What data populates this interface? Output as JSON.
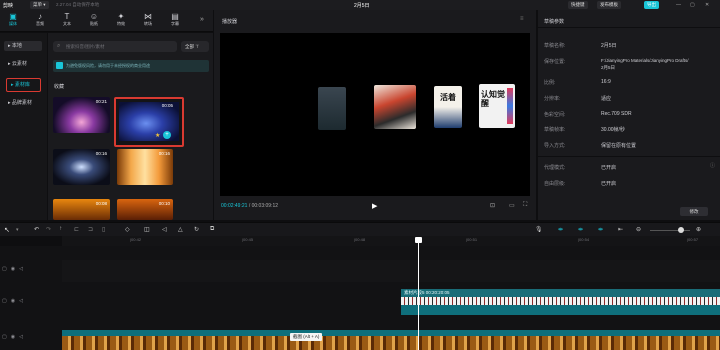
{
  "titlebar": {
    "app_name": "剪映",
    "menu": "菜单 ▾",
    "notice": "2.27.04 自动保存本地",
    "project_title": "2月5日",
    "btn_shortcut": "快捷键",
    "btn_template": "发布模板",
    "btn_export": "导出"
  },
  "toolbar": {
    "items": [
      {
        "icon": "media-icon",
        "glyph": "▣",
        "label": "媒体"
      },
      {
        "icon": "audio-icon",
        "glyph": "♪",
        "label": "音频"
      },
      {
        "icon": "text-icon",
        "glyph": "T",
        "label": "文本"
      },
      {
        "icon": "sticker-icon",
        "glyph": "☺",
        "label": "贴纸"
      },
      {
        "icon": "effects-icon",
        "glyph": "✦",
        "label": "特效"
      },
      {
        "icon": "transition-icon",
        "glyph": "⋈",
        "label": "转场"
      },
      {
        "icon": "caption-icon",
        "glyph": "▤",
        "label": "字幕"
      }
    ],
    "collapse": "»"
  },
  "sidebar": {
    "items": [
      {
        "label": "▸ 本地"
      },
      {
        "label": "▸ 云素材"
      },
      {
        "label": "▸ 素材库"
      },
      {
        "label": "▸ 品牌素材"
      }
    ]
  },
  "library": {
    "search_placeholder": "搜索抖音/图片/素材",
    "filter_label": "全部",
    "banner": "为避免版权风险，请勿用于未经授权的商业用途",
    "section": "收藏",
    "thumbs": [
      {
        "duration": "00:21"
      },
      {
        "duration": "00:05"
      },
      {
        "duration": "00:16"
      },
      {
        "duration": "00:16"
      },
      {
        "duration": "00:08"
      },
      {
        "duration": "00:10"
      }
    ]
  },
  "player": {
    "title": "播放器",
    "time_current": "00:02:49:21",
    "time_total": "00:03:09:12",
    "poster_texts": [
      "",
      "",
      "活着",
      "认知觉醒"
    ]
  },
  "details": {
    "title": "草稿参数",
    "rows": [
      {
        "k": "草稿名称:",
        "v": "2月5日"
      },
      {
        "k": "保存位置:",
        "v": "F:/JianyingPro Materials/JianyingPro Drafts/"
      },
      {
        "k": "",
        "v": "2月5日"
      },
      {
        "k": "比例:",
        "v": "16:9"
      },
      {
        "k": "分辨率:",
        "v": "适应"
      },
      {
        "k": "色彩空间:",
        "v": "Rec.709 SDR"
      },
      {
        "k": "草稿帧率:",
        "v": "30.00帧/秒"
      },
      {
        "k": "导入方式:",
        "v": "保留在原有位置"
      },
      {
        "k": "代理模式:",
        "v": "已开启"
      },
      {
        "k": "自由层级:",
        "v": "已开启"
      }
    ],
    "edit_button": "修改"
  },
  "timeline": {
    "ticks": [
      "|00:42",
      "|00:45",
      "|00:48",
      "|00:51",
      "|00:54",
      "|00:57"
    ],
    "clip_label": "素材片段5  00:20:20:05",
    "tooltip": "截图 (Alt + A)"
  },
  "colors": {
    "accent": "#19c6d8",
    "highlight_box": "#d93a31",
    "track_teal": "#0f6f7c"
  }
}
